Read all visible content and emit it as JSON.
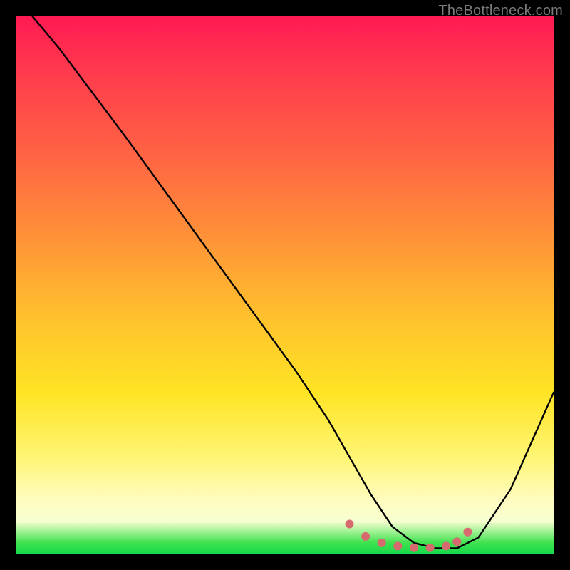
{
  "watermark": "TheBottleneck.com",
  "chart_data": {
    "type": "line",
    "title": "",
    "xlabel": "",
    "ylabel": "",
    "xlim": [
      0,
      100
    ],
    "ylim": [
      0,
      100
    ],
    "series": [
      {
        "name": "curve",
        "color": "#000000",
        "x": [
          3,
          8,
          14,
          20,
          28,
          36,
          44,
          52,
          58,
          62,
          66,
          70,
          74,
          78,
          82,
          86,
          92,
          100
        ],
        "y": [
          100,
          94,
          86,
          78,
          67,
          56,
          45,
          34,
          25,
          18,
          11,
          5,
          2,
          1,
          1,
          3,
          12,
          30
        ]
      }
    ],
    "highlight": {
      "name": "optimal-range",
      "color": "#d66a6e",
      "x": [
        62,
        65,
        68,
        71,
        74,
        77,
        80,
        82,
        84
      ],
      "y": [
        5.5,
        3.2,
        2.0,
        1.4,
        1.1,
        1.1,
        1.4,
        2.2,
        4.0
      ]
    },
    "gradient_stops": [
      {
        "pos": 0,
        "color": "#ff1a53"
      },
      {
        "pos": 28,
        "color": "#ff6a42"
      },
      {
        "pos": 56,
        "color": "#ffc12d"
      },
      {
        "pos": 82,
        "color": "#fff574"
      },
      {
        "pos": 94,
        "color": "#f6ffd0"
      },
      {
        "pos": 100,
        "color": "#17d94b"
      }
    ]
  }
}
